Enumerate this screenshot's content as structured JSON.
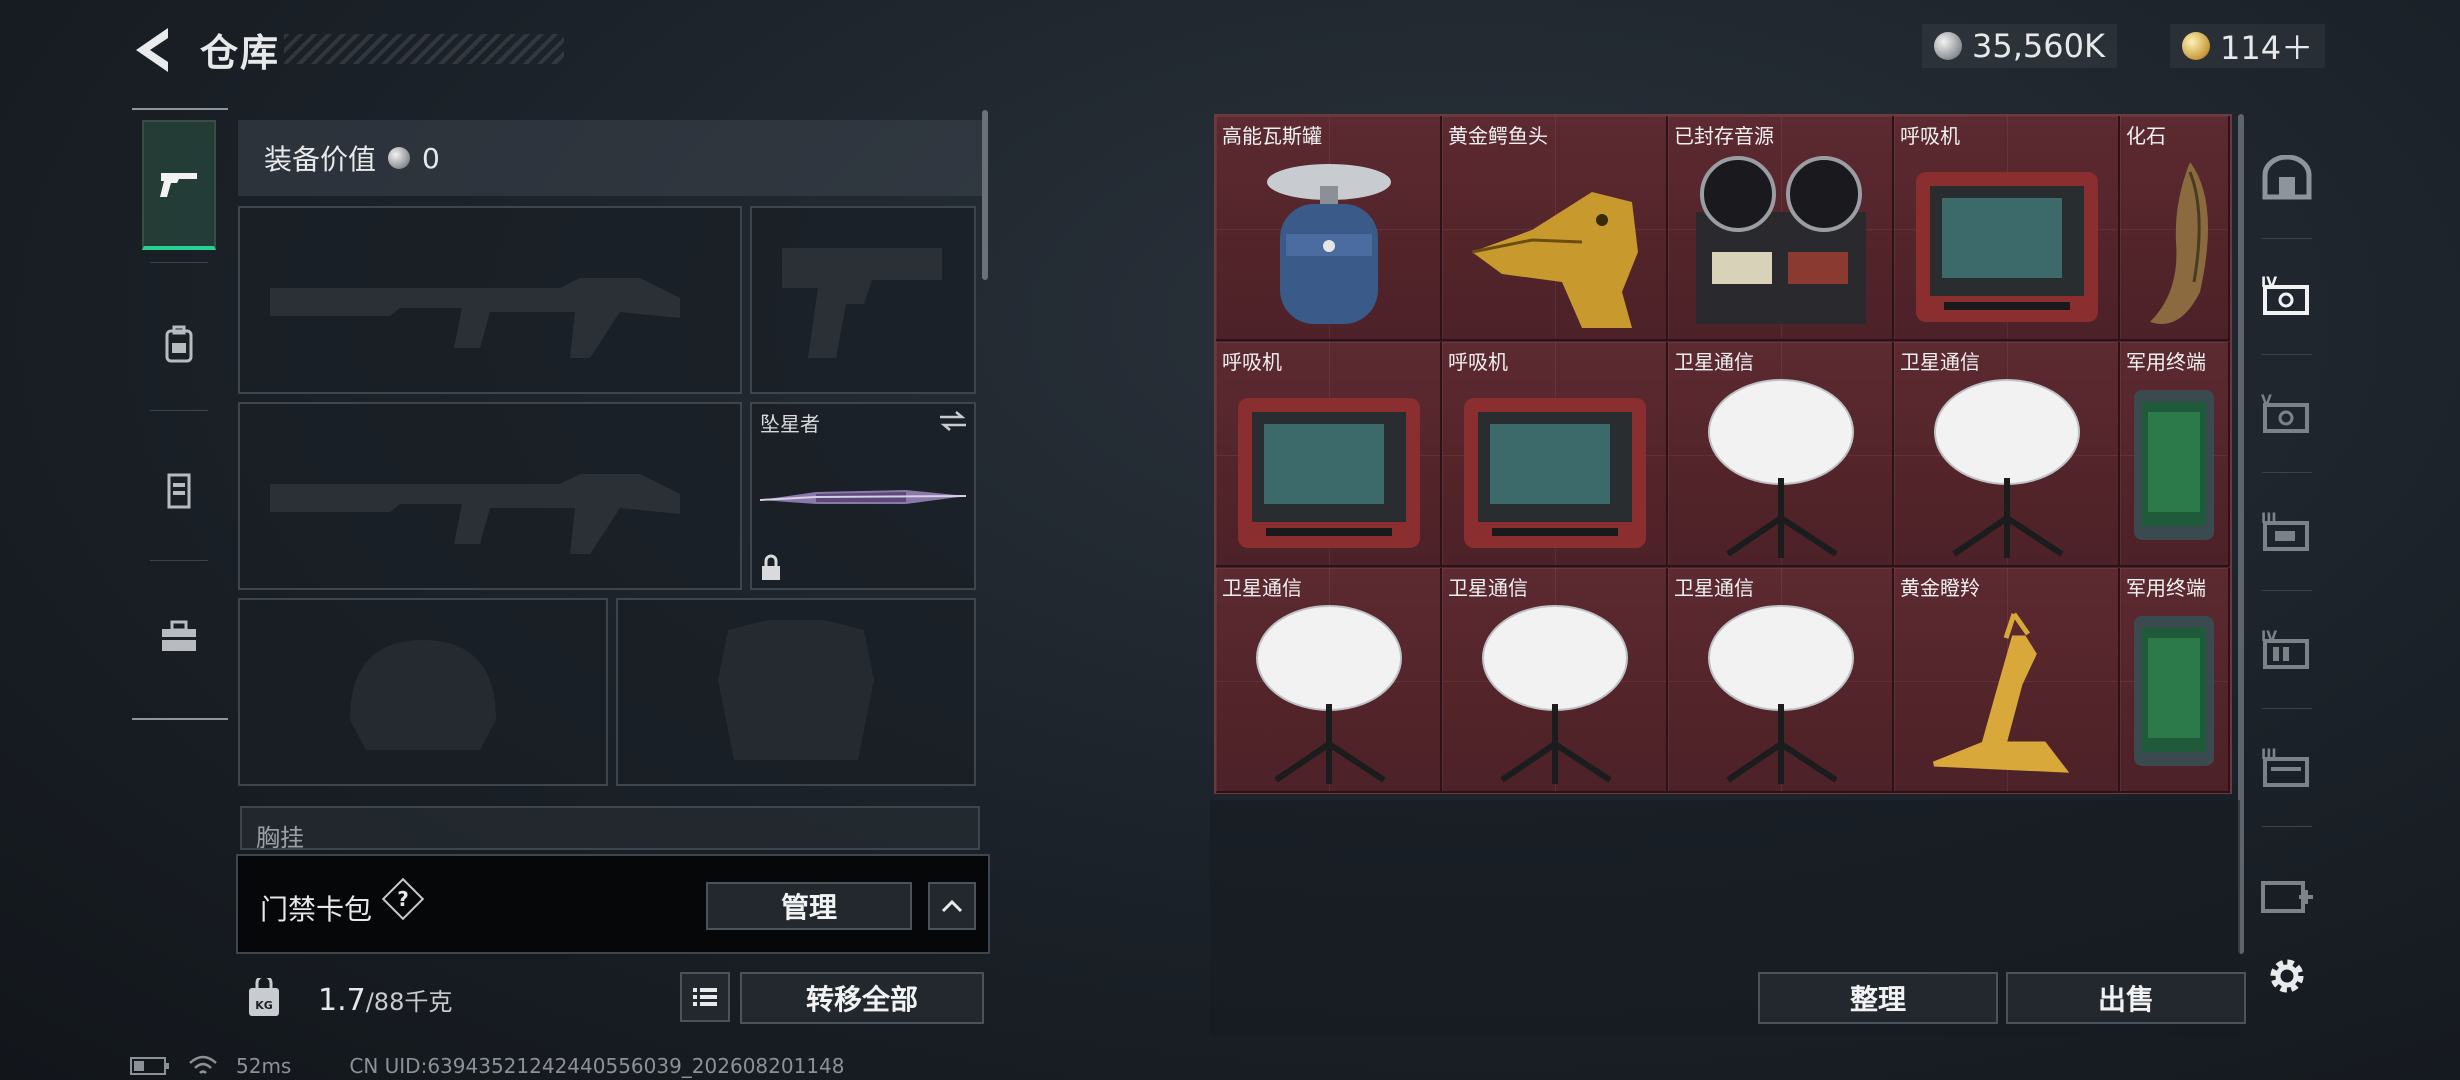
{
  "header": {
    "title": "仓库",
    "currencies": [
      {
        "icon": "silver-coin-icon",
        "value": "35,560K"
      },
      {
        "icon": "gold-coin-icon",
        "value": "114＋"
      }
    ]
  },
  "left_nav": [
    "pistol-icon",
    "backpack-icon",
    "vest-icon",
    "toolbox-icon"
  ],
  "loadout": {
    "equipment_value_label": "装备价值",
    "equipment_value": "0",
    "melee_name": "坠星者",
    "chest_rig_label": "胸挂",
    "card_bag_label": "门禁卡包",
    "help_symbol": "?",
    "manage_button": "管理",
    "weight_value": "1.7",
    "weight_capacity": "/88千克",
    "weight_icon_text": "KG",
    "transfer_all_button": "转移全部"
  },
  "storage": {
    "items": [
      {
        "name": "高能瓦斯罐",
        "icon": "gas-canister"
      },
      {
        "name": "黄金鳄鱼头",
        "icon": "golden-crocodile"
      },
      {
        "name": "已封存音源",
        "icon": "reel-recorder"
      },
      {
        "name": "呼吸机",
        "icon": "ventilator"
      },
      {
        "name": "化石",
        "icon": "fossil-claw"
      },
      {
        "name": "呼吸机",
        "icon": "ventilator"
      },
      {
        "name": "呼吸机",
        "icon": "ventilator"
      },
      {
        "name": "卫星通信",
        "icon": "satellite-dish"
      },
      {
        "name": "卫星通信",
        "icon": "satellite-dish"
      },
      {
        "name": "军用终端",
        "icon": "military-terminal"
      },
      {
        "name": "卫星通信",
        "icon": "satellite-dish"
      },
      {
        "name": "卫星通信",
        "icon": "satellite-dish"
      },
      {
        "name": "卫星通信",
        "icon": "satellite-dish"
      },
      {
        "name": "黄金瞪羚",
        "icon": "golden-gazelle"
      },
      {
        "name": "军用终端",
        "icon": "military-terminal"
      }
    ],
    "organize_button": "整理",
    "sell_button": "出售"
  },
  "right_nav": [
    "bunker-icon",
    "safe-box-iv-icon",
    "safe-box-v-icon",
    "safe-box-iii-icon",
    "safe-box-iv-b-icon",
    "safe-box-iii-b-icon",
    "add-storage-icon",
    "settings-icon"
  ],
  "footer": {
    "ping": "52ms",
    "uid": "CN UID:6394352124244055603­9_202608201148"
  },
  "colors": {
    "accent_green": "#27d191",
    "storage_bg": "#4a2428"
  }
}
